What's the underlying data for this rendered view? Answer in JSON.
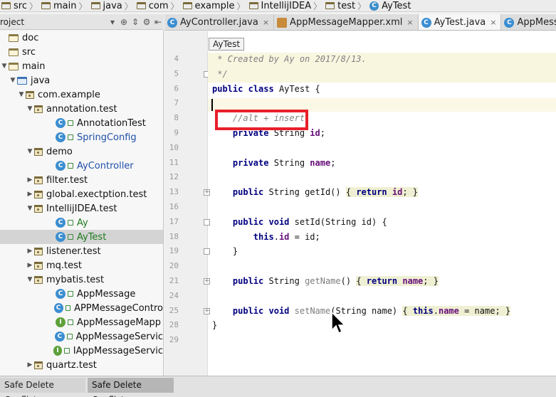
{
  "breadcrumb": [
    {
      "label": "src",
      "icon": "folder-icon"
    },
    {
      "label": "main",
      "icon": "folder-icon"
    },
    {
      "label": "java",
      "icon": "folder-icon"
    },
    {
      "label": "com",
      "icon": "folder-icon"
    },
    {
      "label": "example",
      "icon": "folder-icon"
    },
    {
      "label": "IntellijIDEA",
      "icon": "folder-icon"
    },
    {
      "label": "test",
      "icon": "folder-icon"
    },
    {
      "label": "AyTest",
      "icon": "class-icon"
    }
  ],
  "project_panel": {
    "title": "roject",
    "toolbar_icons": [
      "dropdown-icon",
      "target-icon",
      "collapse-icon",
      "gear-icon",
      "hide-icon"
    ],
    "tree": [
      {
        "label": "doc",
        "type": "folder",
        "arrow": ""
      },
      {
        "label": "src",
        "type": "folder",
        "arrow": ""
      },
      {
        "label": "main",
        "type": "folder",
        "arrow": "down"
      },
      {
        "label": "java",
        "type": "src-folder",
        "arrow": "down"
      },
      {
        "label": "com.example",
        "type": "package",
        "arrow": "down"
      },
      {
        "label": "annotation.test",
        "type": "package",
        "arrow": "down"
      },
      {
        "label": "AnnotationTest",
        "type": "class",
        "arrow": "",
        "style": "normal"
      },
      {
        "label": "SpringConfig",
        "type": "class",
        "arrow": "",
        "style": "blue"
      },
      {
        "label": "demo",
        "type": "package",
        "arrow": "down"
      },
      {
        "label": "AyController",
        "type": "class",
        "arrow": "",
        "style": "blue"
      },
      {
        "label": "filter.test",
        "type": "package",
        "arrow": "right"
      },
      {
        "label": "global.exectption.test",
        "type": "package",
        "arrow": "right"
      },
      {
        "label": "IntellijIDEA.test",
        "type": "package",
        "arrow": "down"
      },
      {
        "label": "Ay",
        "type": "class",
        "arrow": "",
        "style": "green"
      },
      {
        "label": "AyTest",
        "type": "class",
        "arrow": "",
        "style": "green",
        "selected": true
      },
      {
        "label": "listener.test",
        "type": "package",
        "arrow": "right"
      },
      {
        "label": "mq.test",
        "type": "package",
        "arrow": "right"
      },
      {
        "label": "mybatis.test",
        "type": "package",
        "arrow": "down"
      },
      {
        "label": "AppMessage",
        "type": "class",
        "arrow": "",
        "style": "normal"
      },
      {
        "label": "APPMessageContro",
        "type": "class",
        "arrow": "",
        "style": "normal"
      },
      {
        "label": "AppMessageMapp",
        "type": "interface",
        "arrow": "",
        "style": "normal"
      },
      {
        "label": "AppMessageServic",
        "type": "class",
        "arrow": "",
        "style": "normal"
      },
      {
        "label": "IAppMessageServic",
        "type": "interface",
        "arrow": "",
        "style": "normal"
      },
      {
        "label": "quartz.test",
        "type": "package",
        "arrow": "right"
      }
    ]
  },
  "tabs": [
    {
      "label": "AyController.java",
      "icon": "class-icon",
      "active": false
    },
    {
      "label": "AppMessageMapper.xml",
      "icon": "xml-icon",
      "active": false
    },
    {
      "label": "AyTest.java",
      "icon": "class-icon",
      "active": true
    },
    {
      "label": "AppMess",
      "icon": "class-icon",
      "active": false
    }
  ],
  "tooltip": "AyTest",
  "editor": {
    "lines": [
      {
        "n": "4",
        "text": " * Created by Ay on 2017/8/13."
      },
      {
        "n": "5",
        "text": " */"
      },
      {
        "n": "6",
        "text": "public class AyTest {"
      },
      {
        "n": "7",
        "text": ""
      },
      {
        "n": "8",
        "text": "    //alt + insert"
      },
      {
        "n": "9",
        "text": "    private String id;"
      },
      {
        "n": "10",
        "text": ""
      },
      {
        "n": "11",
        "text": "    private String name;"
      },
      {
        "n": "12",
        "text": ""
      },
      {
        "n": "13",
        "text": "    public String getId() { return id; }"
      },
      {
        "n": "16",
        "text": ""
      },
      {
        "n": "17",
        "text": "    public void setId(String id) {"
      },
      {
        "n": "18",
        "text": "        this.id = id;"
      },
      {
        "n": "19",
        "text": "    }"
      },
      {
        "n": "20",
        "text": ""
      },
      {
        "n": "21",
        "text": "    public String getName() { return name; }"
      },
      {
        "n": "24",
        "text": ""
      },
      {
        "n": "25",
        "text": "    public void setName(String name) { this.name = name; }"
      },
      {
        "n": "28",
        "text": "}"
      },
      {
        "n": "29",
        "text": ""
      }
    ]
  },
  "bottom_tabs": [
    "Safe Delete Conflicts",
    "Safe Delete Conflicts"
  ]
}
